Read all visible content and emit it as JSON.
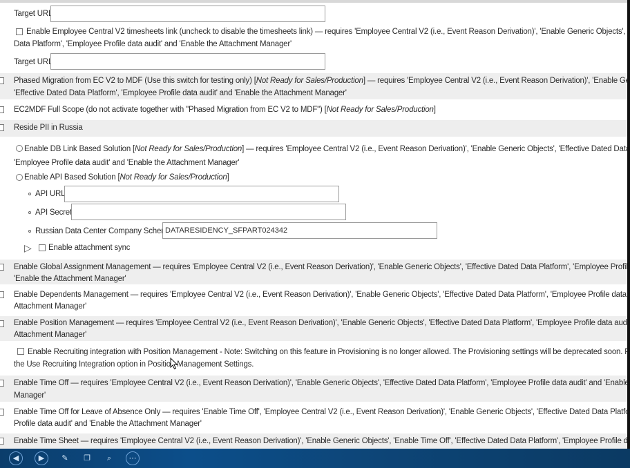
{
  "target_url_1": {
    "label": "Target URL",
    "value": ""
  },
  "ec_timesheets": {
    "line1": "Enable Employee Central V2 timesheets link (uncheck to disable the timesheets link)  — requires 'Employee Central V2 (i.e., Event Reason Derivation)', 'Enable Generic Objects', 'Effective Dated",
    "line2": "Data Platform', 'Employee Profile data audit' and 'Enable the Attachment Manager'"
  },
  "target_url_2": {
    "label": "Target URL",
    "value": ""
  },
  "phased_migration": {
    "line1_a": "Phased Migration from EC V2 to MDF (Use this switch for testing only) [",
    "line1_em": "Not Ready for Sales/Production",
    "line1_b": "] — requires 'Employee Central V2 (i.e., Event Reason Derivation)', 'Enable Generic Objects',",
    "line2": "'Effective Dated Data Platform', 'Employee Profile data audit' and 'Enable the Attachment Manager'"
  },
  "ec2mdf": {
    "text_a": "EC2MDF Full Scope (do not activate together with \"Phased Migration from EC V2 to MDF\") [",
    "text_em": "Not Ready for Sales/Production",
    "text_b": "]"
  },
  "reside_pii": {
    "label": "Reside PII in Russia"
  },
  "db_link": {
    "line1_a": "Enable DB Link Based Solution [",
    "line1_em": "Not Ready for Sales/Production",
    "line1_b": "] — requires 'Employee Central V2 (i.e., Event Reason Derivation)', 'Enable Generic Objects', 'Effective Dated Data Platform',",
    "line2": "'Employee Profile data audit' and 'Enable the Attachment Manager'"
  },
  "api_solution": {
    "text_a": "Enable API Based Solution [",
    "text_em": "Not Ready for Sales/Production",
    "text_b": "]",
    "api_url": {
      "label": "API URL",
      "value": ""
    },
    "api_secret": {
      "label": "API Secret",
      "value": ""
    },
    "schema": {
      "label": "Russian Data Center Company Schema",
      "value": "DATARESIDENCY_SFPART024342"
    }
  },
  "attachment_sync": {
    "label": "Enable attachment sync"
  },
  "global_assignment": {
    "line1": "Enable Global Assignment Management — requires 'Employee Central V2 (i.e., Event Reason Derivation)', 'Enable Generic Objects', 'Effective Dated Data Platform', 'Employee Profile data audit' and",
    "line2": "'Enable the Attachment Manager'"
  },
  "dependents": {
    "line1": "Enable Dependents Management — requires 'Employee Central V2 (i.e., Event Reason Derivation)', 'Enable Generic Objects', 'Effective Dated Data Platform', 'Employee Profile data audit' and 'Enable the",
    "line2": "Attachment Manager'"
  },
  "position_mgmt": {
    "line1": "Enable Position Management — requires 'Employee Central V2 (i.e., Event Reason Derivation)', 'Enable Generic Objects', 'Effective Dated Data Platform', 'Employee Profile data audit' and 'Enable the",
    "line2": "Attachment Manager'"
  },
  "recruiting": {
    "line1": "Enable Recruiting integration with Position Management - Note: Switching on this feature in Provisioning is no longer allowed. The Provisioning settings will be deprecated soon. Please use",
    "line2": "the Use Recruiting Integration option in Position Management Settings."
  },
  "time_off": {
    "line1": "Enable Time Off — requires 'Employee Central V2 (i.e., Event Reason Derivation)', 'Enable Generic Objects', 'Effective Dated Data Platform', 'Employee Profile data audit' and 'Enable the Attachment",
    "line2": "Manager'"
  },
  "time_off_loa": {
    "line1": "Enable Time Off for Leave of Absence Only — requires 'Enable Time Off', 'Employee Central V2 (i.e., Event Reason Derivation)', 'Enable Generic Objects', 'Effective Dated Data Platform', 'Employee",
    "line2": "Profile data audit' and 'Enable the Attachment Manager'"
  },
  "time_sheet": {
    "line1": "Enable Time Sheet — requires 'Employee Central V2 (i.e., Event Reason Derivation)', 'Enable Generic Objects', 'Enable Time Off', 'Effective Dated Data Platform', 'Employee Profile data audit' and 'Enable"
  },
  "taskbar": {
    "icons": [
      "back-icon",
      "forward-icon",
      "pen-icon",
      "copy-icon",
      "zoom-icon",
      "more-icon"
    ],
    "glyphs": [
      "◀",
      "▶",
      "✎",
      "❐",
      "⌕",
      "⋯"
    ]
  }
}
